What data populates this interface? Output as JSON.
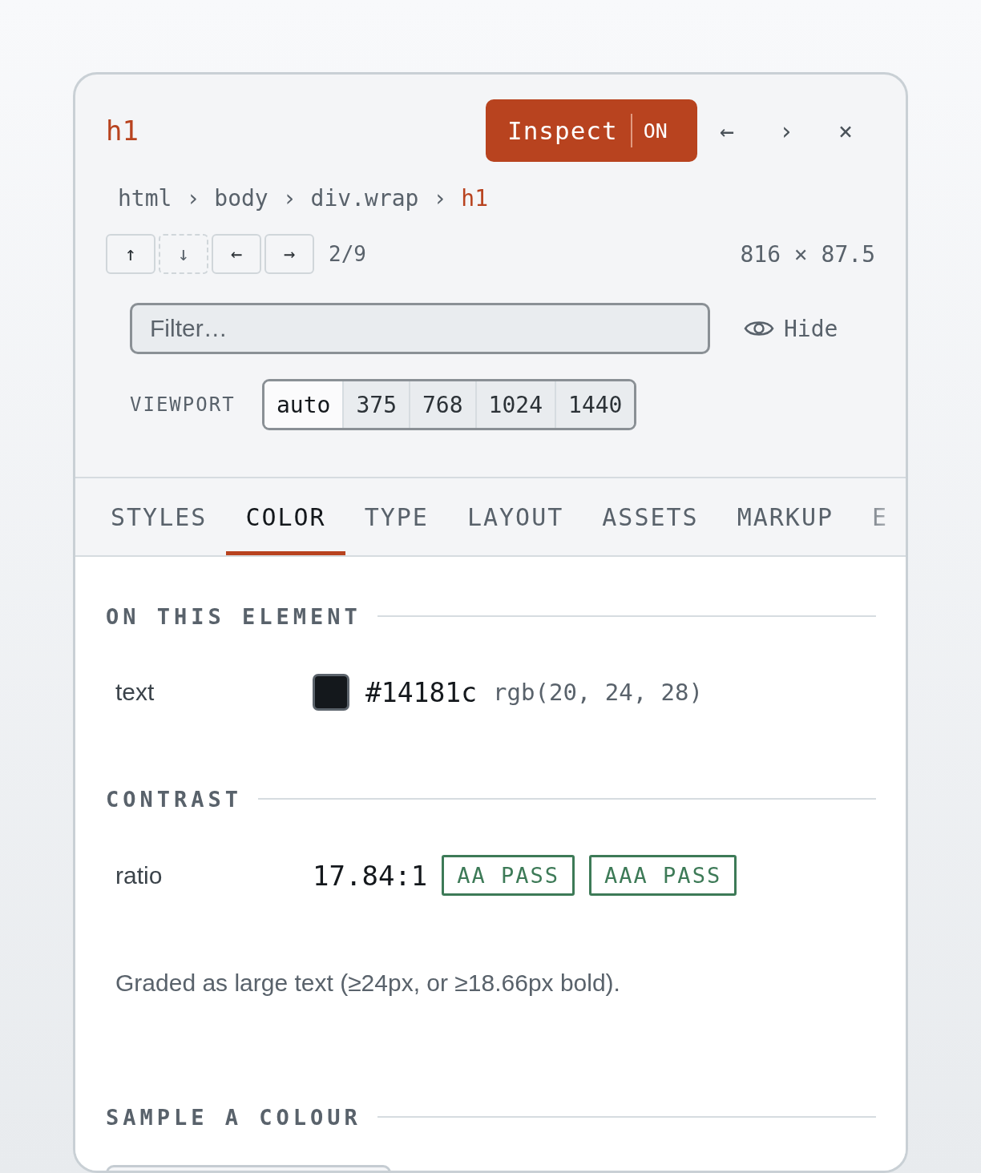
{
  "header": {
    "element_tag": "h1",
    "inspect": {
      "label": "Inspect",
      "state_label": "ON",
      "on": true
    },
    "icon_buttons": [
      {
        "label": "←"
      },
      {
        "label": "›"
      },
      {
        "label": "×"
      }
    ],
    "breadcrumb": [
      {
        "kind": "crumb",
        "label": "html",
        "current": false
      },
      {
        "kind": "separator",
        "label": "›"
      },
      {
        "kind": "crumb",
        "label": "body",
        "current": false
      },
      {
        "kind": "separator",
        "label": "›"
      },
      {
        "kind": "crumb",
        "label": "div.wrap",
        "current": false
      },
      {
        "kind": "separator",
        "label": "›"
      },
      {
        "kind": "crumb",
        "label": "h1",
        "current": true
      }
    ],
    "nav_buttons": [
      {
        "label": "↑",
        "disabled": false
      },
      {
        "label": "↓",
        "disabled": true
      },
      {
        "label": "←",
        "disabled": false
      },
      {
        "label": "→",
        "disabled": false
      }
    ],
    "position": "2/9",
    "size": "816 × 87.5",
    "filter": {
      "placeholder": "Filter…"
    },
    "hide": {
      "label": "Hide"
    },
    "viewport": {
      "label": "VIEWPORT",
      "options": [
        {
          "label": "auto",
          "selected": true
        },
        {
          "label": "375",
          "selected": false
        },
        {
          "label": "768",
          "selected": false
        },
        {
          "label": "1024",
          "selected": false
        },
        {
          "label": "1440",
          "selected": false
        }
      ]
    }
  },
  "tabs": [
    {
      "label": "STYLES",
      "selected": false
    },
    {
      "label": "COLOR",
      "selected": true
    },
    {
      "label": "TYPE",
      "selected": false
    },
    {
      "label": "LAYOUT",
      "selected": false
    },
    {
      "label": "ASSETS",
      "selected": false
    },
    {
      "label": "MARKUP",
      "selected": false
    },
    {
      "label": "E",
      "selected": false
    }
  ],
  "sections": [
    {
      "kind": "colors",
      "title": "ON THIS ELEMENT",
      "rows": [
        {
          "label": "text",
          "color": "#14181c",
          "hex": "#14181c",
          "rgb": "rgb(20, 24, 28)"
        }
      ]
    },
    {
      "kind": "contrast",
      "title": "CONTRAST",
      "rows": [
        {
          "label": "ratio",
          "value": "17.84:1",
          "badges": [
            {
              "label": "AA PASS",
              "pass": true
            },
            {
              "label": "AAA PASS",
              "pass": true
            }
          ]
        }
      ],
      "note": "Graded as large text (≥24px, or ≥18.66px bold)."
    },
    {
      "kind": "sample",
      "title": "SAMPLE A COLOUR"
    }
  ]
}
